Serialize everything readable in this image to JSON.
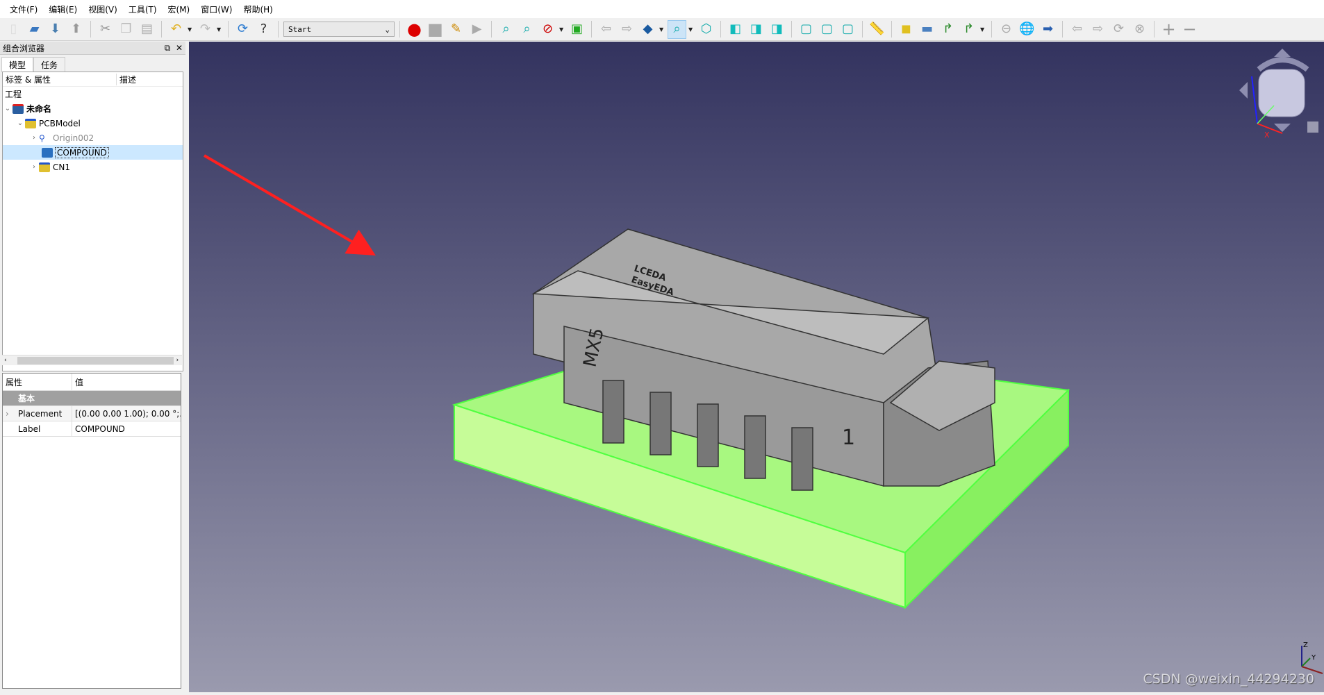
{
  "menu": [
    "文件(F)",
    "编辑(E)",
    "视图(V)",
    "工具(T)",
    "宏(M)",
    "窗口(W)",
    "帮助(H)"
  ],
  "toolbar": {
    "macro_select": "Start"
  },
  "combo_view": {
    "title": "组合浏览器",
    "tabs": [
      "模型",
      "任务"
    ],
    "tree_headers": [
      "标签 & 属性",
      "描述"
    ],
    "section": "工程",
    "items": [
      {
        "label": "未命名",
        "level": 0,
        "expanded": true,
        "icon": "document-icon"
      },
      {
        "label": "PCBModel",
        "level": 1,
        "expanded": true,
        "icon": "part-icon"
      },
      {
        "label": "Origin002",
        "level": 2,
        "expanded": false,
        "icon": "origin-icon",
        "dimmed": true
      },
      {
        "label": "COMPOUND",
        "level": 2,
        "selected": true,
        "icon": "compound-icon"
      },
      {
        "label": "CN1",
        "level": 2,
        "expanded": false,
        "icon": "part-icon"
      }
    ]
  },
  "properties": {
    "headers": [
      "属性",
      "值"
    ],
    "group": "基本",
    "rows": [
      {
        "name": "Placement",
        "value": "[(0.00 0.00 1.00); 0.00 °;..."
      },
      {
        "name": "Label",
        "value": "COMPOUND"
      }
    ]
  },
  "viewport": {
    "model_text": [
      "LCEDA",
      "EasyEDA",
      "MX5",
      "1"
    ],
    "axes": [
      "X",
      "Y",
      "Z"
    ],
    "watermark": "CSDN @weixin_44294230"
  },
  "colors": {
    "selection": "#80ff60",
    "bg_top": "#33335f",
    "bg_bottom": "#9a9aae",
    "arrow": "#ff2020"
  }
}
